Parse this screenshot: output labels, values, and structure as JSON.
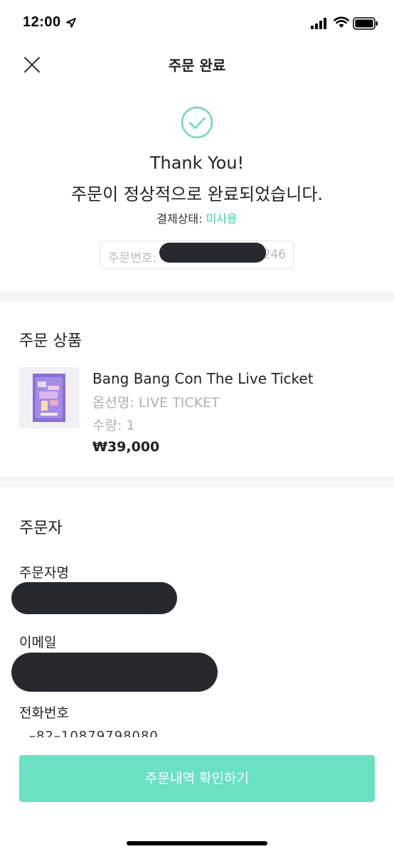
{
  "status_bar": {
    "time": "12:00"
  },
  "header": {
    "title": "주문 완료",
    "close_icon": "close-icon"
  },
  "completion": {
    "check_icon": "check-circle-icon",
    "thank_you": "Thank You!",
    "message": "주문이 정상적으로 완료되었습니다.",
    "payment_status_label": "결제상태:",
    "payment_status_value": "미사용",
    "order_number_label": "주문번호:",
    "order_number_tail": "246"
  },
  "product_section": {
    "title": "주문 상품",
    "item": {
      "name": "Bang Bang Con The Live Ticket",
      "option": "옵션명: LIVE TICKET",
      "quantity": "수량: 1",
      "price": "₩39,000"
    }
  },
  "orderer_section": {
    "title": "주문자",
    "name_label": "주문자명",
    "email_label": "이메일",
    "phone_label": "전화번호"
  },
  "footer": {
    "confirm_label": "주문내역 확인하기"
  },
  "colors": {
    "accent": "#3ccfae",
    "button": "#6ae1c3",
    "redaction": "#262a2e"
  }
}
